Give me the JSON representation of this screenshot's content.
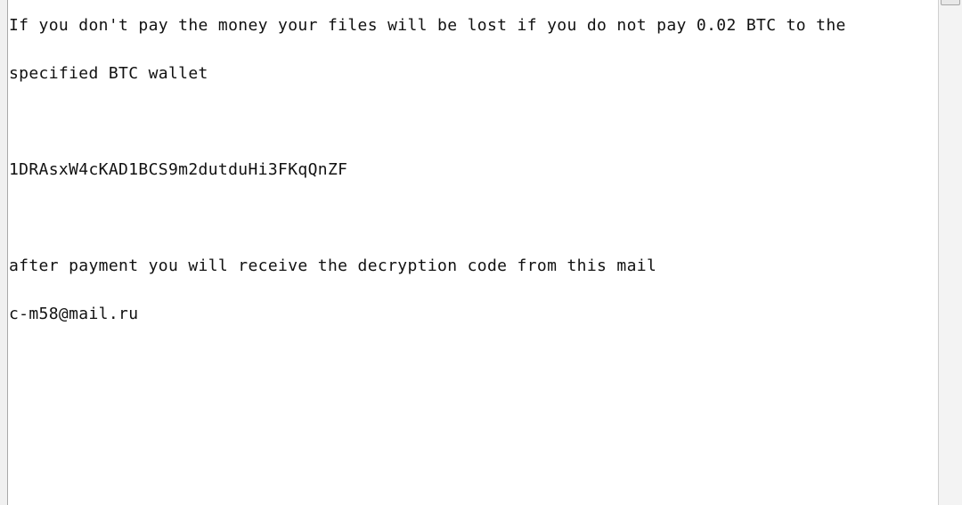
{
  "document": {
    "lines": [
      "If you don't pay the money your files will be lost if you do not pay 0.02 BTC to the",
      "specified BTC wallet",
      "",
      "1DRAsxW4cKAD1BCS9m2dutduHi3FKqQnZF",
      "",
      "after payment you will receive the decryption code from this mail",
      "c-m58@mail.ru"
    ]
  }
}
